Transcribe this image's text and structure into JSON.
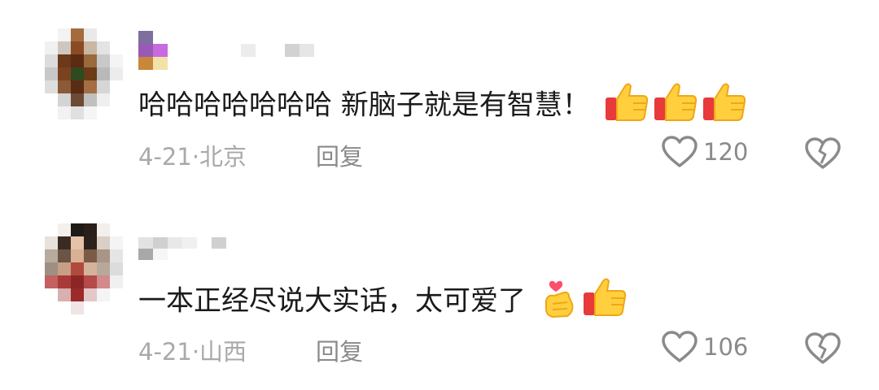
{
  "comments": [
    {
      "text": "哈哈哈哈哈哈哈 新脑子就是有智慧！",
      "emojis": [
        "thumbs-up-icon",
        "thumbs-up-icon",
        "thumbs-up-icon"
      ],
      "date": "4-21",
      "separator": "·",
      "location": "北京",
      "reply_label": "回复",
      "like_count": "120"
    },
    {
      "text": "一本正经尽说大实话，太可爱了",
      "emojis": [
        "finger-heart-icon",
        "thumbs-up-icon"
      ],
      "date": "4-21",
      "separator": "·",
      "location": "山西",
      "reply_label": "回复",
      "like_count": "106"
    }
  ]
}
